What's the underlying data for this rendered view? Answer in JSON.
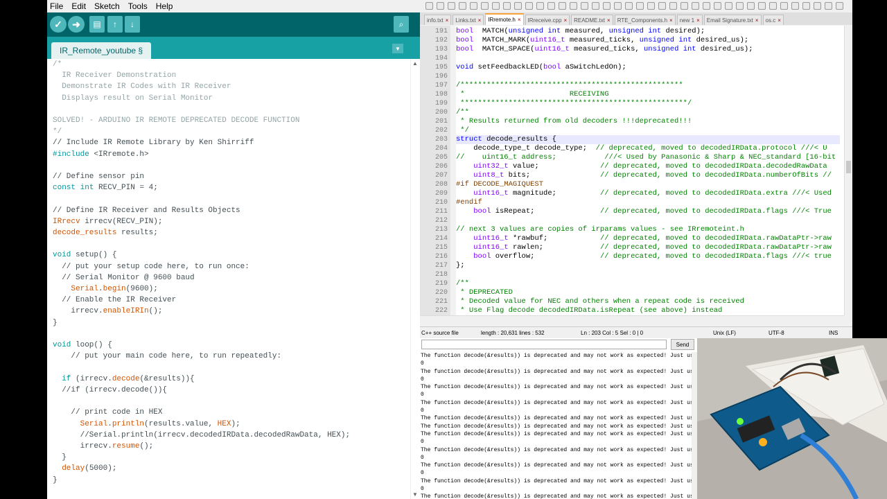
{
  "arduino": {
    "menu": [
      "File",
      "Edit",
      "Sketch",
      "Tools",
      "Help"
    ],
    "tab": "IR_Remote_youtube §",
    "toolbar": {
      "verify": "✓",
      "upload": "➜",
      "new": "🗋",
      "open": "↑",
      "save": "↓",
      "serial": "⌕"
    },
    "code": [
      [
        [
          "cm",
          "/*"
        ]
      ],
      [
        [
          "cm",
          "  IR Receiver Demonstration"
        ]
      ],
      [
        [
          "cm",
          "  Demonstrate IR Codes with IR Receiver"
        ]
      ],
      [
        [
          "cm",
          "  Displays result on Serial Monitor"
        ]
      ],
      [
        [
          "",
          ""
        ]
      ],
      [
        [
          "cm",
          "SOLVED! - ARDUINO IR REMOTE DEPRECATED DECODE FUNCTION"
        ]
      ],
      [
        [
          "cm",
          "*/"
        ]
      ],
      [
        [
          "",
          "// Include IR Remote Library by Ken Shirriff"
        ]
      ],
      [
        [
          "kw",
          "#include"
        ],
        [
          "",
          " <IRremote.h>"
        ]
      ],
      [
        [
          "",
          ""
        ]
      ],
      [
        [
          "",
          "// Define sensor pin"
        ]
      ],
      [
        [
          "kw",
          "const"
        ],
        [
          "",
          " "
        ],
        [
          "kw",
          "int"
        ],
        [
          "",
          " RECV_PIN = 4;"
        ]
      ],
      [
        [
          "",
          ""
        ]
      ],
      [
        [
          "",
          "// Define IR Receiver and Results Objects"
        ]
      ],
      [
        [
          "ty",
          "IRrecv"
        ],
        [
          "",
          " irrecv(RECV_PIN);"
        ]
      ],
      [
        [
          "ty",
          "decode_results"
        ],
        [
          "",
          " results;"
        ]
      ],
      [
        [
          "",
          ""
        ]
      ],
      [
        [
          "kw",
          "void"
        ],
        [
          "",
          " setup() {"
        ]
      ],
      [
        [
          "",
          "  // put your setup code here, to run once:"
        ]
      ],
      [
        [
          "",
          "  // Serial Monitor @ 9600 baud"
        ]
      ],
      [
        [
          "",
          "    "
        ],
        [
          "ty",
          "Serial"
        ],
        [
          "",
          "."
        ],
        [
          "fn",
          "begin"
        ],
        [
          "",
          "(9600);"
        ]
      ],
      [
        [
          "",
          "  // Enable the IR Receiver"
        ]
      ],
      [
        [
          "",
          "    irrecv."
        ],
        [
          "fn",
          "enableIRIn"
        ],
        [
          "",
          "();"
        ]
      ],
      [
        [
          "",
          "}"
        ]
      ],
      [
        [
          "",
          ""
        ]
      ],
      [
        [
          "kw",
          "void"
        ],
        [
          "",
          " loop() {"
        ]
      ],
      [
        [
          "",
          "    // put your main code here, to run repeatedly:"
        ]
      ],
      [
        [
          "",
          ""
        ]
      ],
      [
        [
          "",
          "  "
        ],
        [
          "kw",
          "if"
        ],
        [
          "",
          " (irrecv."
        ],
        [
          "fn",
          "decode"
        ],
        [
          "",
          "(&results)){"
        ]
      ],
      [
        [
          "",
          "  //if (irrecv.decode()){"
        ]
      ],
      [
        [
          "",
          ""
        ]
      ],
      [
        [
          "",
          "    // print code in HEX"
        ]
      ],
      [
        [
          "",
          "      "
        ],
        [
          "ty",
          "Serial"
        ],
        [
          "",
          "."
        ],
        [
          "fn",
          "println"
        ],
        [
          "",
          "(results.value, "
        ],
        [
          "ty",
          "HEX"
        ],
        [
          "",
          ");"
        ]
      ],
      [
        [
          "",
          "      //Serial.println(irrecv.decodedIRData.decodedRawData, HEX);"
        ]
      ],
      [
        [
          "",
          "      irrecv."
        ],
        [
          "fn",
          "resume"
        ],
        [
          "",
          "();"
        ]
      ],
      [
        [
          "",
          "  }"
        ]
      ],
      [
        [
          "",
          "  "
        ],
        [
          "fn",
          "delay"
        ],
        [
          "",
          "(5000);"
        ]
      ],
      [
        [
          "",
          "}"
        ]
      ]
    ]
  },
  "npp": {
    "tabs": [
      "info.txt",
      "Links.txt",
      "IRremote.h",
      "IRreceive.cpp",
      "README.txt",
      "RTE_Components.h",
      "new 1",
      "Email Signature.txt",
      "os.c"
    ],
    "active_tab": 2,
    "line_numbers": [
      "191",
      "192",
      "193",
      "194",
      "195",
      "196",
      "197",
      "198",
      "199",
      "200",
      "201",
      "202",
      "203",
      "204",
      "205",
      "206",
      "207",
      "208",
      "209",
      "210",
      "211",
      "212",
      "213",
      "214",
      "215",
      "216",
      "217",
      "218",
      "219",
      "220",
      "221",
      "222"
    ],
    "code": [
      [
        [
          "nty",
          "bool"
        ],
        [
          "",
          "  MATCH("
        ],
        [
          "nkw",
          "unsigned int"
        ],
        [
          "",
          " measured, "
        ],
        [
          "nkw",
          "unsigned int"
        ],
        [
          "",
          " desired);"
        ]
      ],
      [
        [
          "nty",
          "bool"
        ],
        [
          "",
          "  MATCH_MARK("
        ],
        [
          "nty",
          "uint16_t"
        ],
        [
          "",
          " measured_ticks, "
        ],
        [
          "nkw",
          "unsigned int"
        ],
        [
          "",
          " desired_us);"
        ]
      ],
      [
        [
          "nty",
          "bool"
        ],
        [
          "",
          "  MATCH_SPACE("
        ],
        [
          "nty",
          "uint16_t"
        ],
        [
          "",
          " measured_ticks, "
        ],
        [
          "nkw",
          "unsigned int"
        ],
        [
          "",
          " desired_us);"
        ]
      ],
      [
        [
          "",
          ""
        ]
      ],
      [
        [
          "nkw",
          "void"
        ],
        [
          "",
          " setFeedbackLED("
        ],
        [
          "nty",
          "bool"
        ],
        [
          "",
          " aSwitchLedOn);"
        ]
      ],
      [
        [
          "",
          ""
        ]
      ],
      [
        [
          "ncm",
          "/***************************************************"
        ]
      ],
      [
        [
          "ncm",
          " *                        RECEIVING"
        ]
      ],
      [
        [
          "ncm",
          " ****************************************************/"
        ]
      ],
      [
        [
          "ncm",
          "/**"
        ]
      ],
      [
        [
          "ncm",
          " * Results returned from old decoders !!!deprecated!!!"
        ]
      ],
      [
        [
          "ncm",
          " */"
        ]
      ],
      [
        [
          "nkw",
          "struct"
        ],
        [
          "",
          " decode_results {"
        ]
      ],
      [
        [
          "",
          "    decode_type_t decode_type;  "
        ],
        [
          "ncm",
          "// deprecated, moved to decodedIRData.protocol ///< U"
        ]
      ],
      [
        [
          "ncm",
          "//    uint16_t address;           ///< Used by Panasonic & Sharp & NEC_standard [16-bit"
        ]
      ],
      [
        [
          "",
          "    "
        ],
        [
          "nty",
          "uint32_t"
        ],
        [
          "",
          " value;              "
        ],
        [
          "ncm",
          "// deprecated, moved to decodedIRData.decodedRawData"
        ]
      ],
      [
        [
          "",
          "    "
        ],
        [
          "nty",
          "uint8_t"
        ],
        [
          "",
          " bits;                "
        ],
        [
          "ncm",
          "// deprecated, moved to decodedIRData.numberOfBits //"
        ]
      ],
      [
        [
          "npp",
          "#if DECODE_MAGIQUEST"
        ]
      ],
      [
        [
          "",
          "    "
        ],
        [
          "nty",
          "uint16_t"
        ],
        [
          "",
          " magnitude;          "
        ],
        [
          "ncm",
          "// deprecated, moved to decodedIRData.extra ///< Used"
        ]
      ],
      [
        [
          "npp",
          "#endif"
        ]
      ],
      [
        [
          "",
          "    "
        ],
        [
          "nty",
          "bool"
        ],
        [
          "",
          " isRepeat;               "
        ],
        [
          "ncm",
          "// deprecated, moved to decodedIRData.flags ///< True"
        ]
      ],
      [
        [
          "",
          ""
        ]
      ],
      [
        [
          "ncm",
          "// next 3 values are copies of irparams values - see IRremoteint.h"
        ]
      ],
      [
        [
          "",
          "    "
        ],
        [
          "nty",
          "uint16_t"
        ],
        [
          "",
          " *rawbuf;            "
        ],
        [
          "ncm",
          "// deprecated, moved to decodedIRData.rawDataPtr->raw"
        ]
      ],
      [
        [
          "",
          "    "
        ],
        [
          "nty",
          "uint16_t"
        ],
        [
          "",
          " rawlen;             "
        ],
        [
          "ncm",
          "// deprecated, moved to decodedIRData.rawDataPtr->raw"
        ]
      ],
      [
        [
          "",
          "    "
        ],
        [
          "nty",
          "bool"
        ],
        [
          "",
          " overflow;               "
        ],
        [
          "ncm",
          "// deprecated, moved to decodedIRData.flags ///< true"
        ]
      ],
      [
        [
          "",
          "};"
        ]
      ],
      [
        [
          "",
          ""
        ]
      ],
      [
        [
          "ncm",
          "/**"
        ]
      ],
      [
        [
          "ncm",
          " * DEPRECATED"
        ]
      ],
      [
        [
          "ncm",
          " * Decoded value for NEC and others when a repeat code is received"
        ]
      ],
      [
        [
          "ncm",
          " * Use Flag decode decodedIRData.isRepeat (see above) instead"
        ]
      ]
    ],
    "status": {
      "file_type": "C++ source file",
      "length": "length : 20,631    lines : 532",
      "position": "Ln : 203    Col : 5    Sel : 0 | 0",
      "eol": "Unix (LF)",
      "encoding": "UTF-8",
      "mode": "INS"
    }
  },
  "serial": {
    "send_label": "Send",
    "lines": [
      "The function decode(&results)) is deprecated and may not work as expected! Just use",
      "0",
      "The function decode(&results)) is deprecated and may not work as expected! Just use",
      "0",
      "The function decode(&results)) is deprecated and may not work as expected! Just use",
      "0",
      "The function decode(&results)) is deprecated and may not work as expected! Just use",
      "0",
      "The function decode(&results)) is deprecated and may not work as expected! Just use",
      "The function decode(&results)) is deprecated and may not work as expected! Just use",
      "The function decode(&results)) is deprecated and may not work as expected! Just use",
      "0",
      "The function decode(&results)) is deprecated and may not work as expected! Just use",
      "0",
      "The function decode(&results)) is deprecated and may not work as expected! Just use",
      "0",
      "The function decode(&results)) is deprecated and may not work as expected! Just use",
      "0",
      "The function decode(&results)) is deprecated and may not work as expected! Just use",
      "The function decode(&results)) is deprecated and may not work as expected! Just use"
    ]
  }
}
